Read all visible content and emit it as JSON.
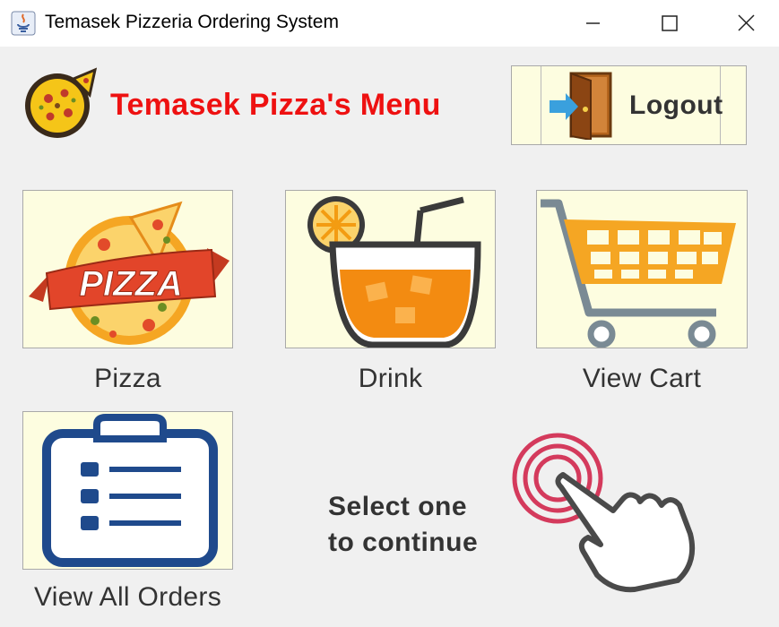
{
  "window": {
    "title": "Temasek Pizzeria Ordering System",
    "controls": [
      "minimize-icon",
      "maximize-icon",
      "close-icon"
    ]
  },
  "header": {
    "logo_icon": "pizza-logo-icon",
    "menu_title": "Temasek Pizza's Menu",
    "logout_label": "Logout",
    "logout_icon": "exit-door-icon"
  },
  "tiles": [
    {
      "label": "Pizza",
      "icon": "pizza-icon"
    },
    {
      "label": "Drink",
      "icon": "drink-icon"
    },
    {
      "label": "View Cart",
      "icon": "shopping-cart-icon"
    },
    {
      "label": "View All Orders",
      "icon": "clipboard-icon"
    }
  ],
  "prompt": {
    "line1": "Select one",
    "line2": "to continue",
    "icon": "pointing-hand-icon"
  },
  "colors": {
    "title_red": "#ee1111",
    "tile_background": "#fdfde0",
    "window_background": "#f0f0f0"
  }
}
